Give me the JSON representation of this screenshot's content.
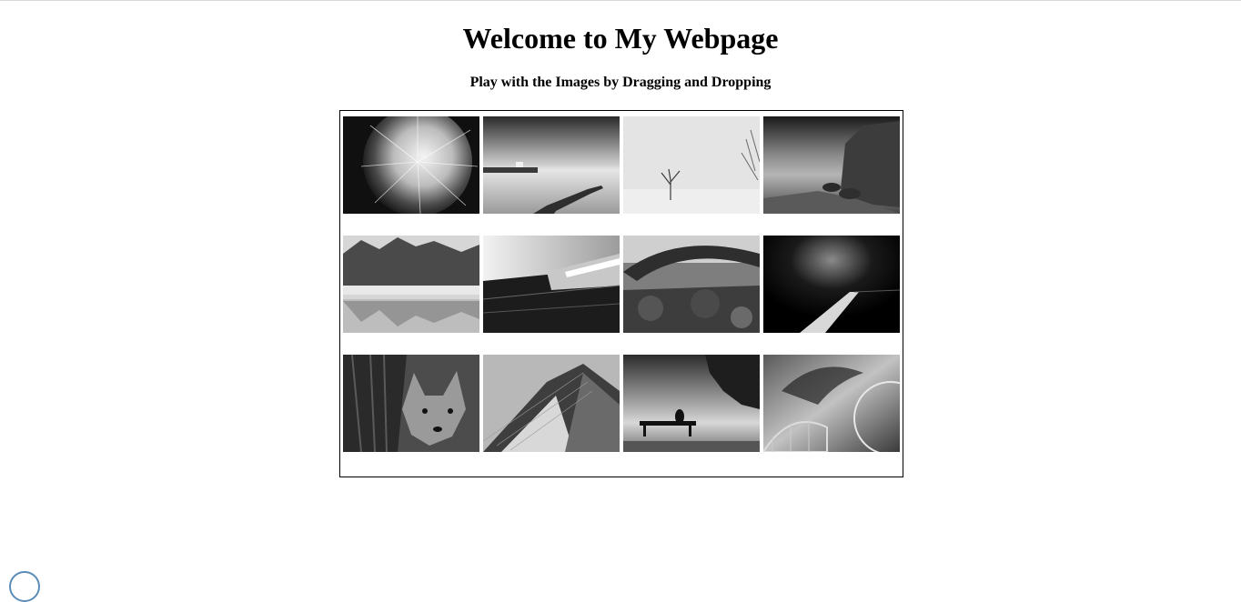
{
  "page": {
    "title": "Welcome to My Webpage",
    "subtitle": "Play with the Images by Dragging and Dropping"
  },
  "gallery": {
    "images": [
      {
        "subject": "dandelion-seed-head"
      },
      {
        "subject": "coastline-long-exposure"
      },
      {
        "subject": "lone-tree-in-fog"
      },
      {
        "subject": "sea-cliffs"
      },
      {
        "subject": "misty-lake-trees"
      },
      {
        "subject": "modern-architecture-reflection"
      },
      {
        "subject": "rock-arch-landscape"
      },
      {
        "subject": "pier-into-darkness"
      },
      {
        "subject": "fox-behind-tree"
      },
      {
        "subject": "glass-skyscraper"
      },
      {
        "subject": "person-on-bench"
      },
      {
        "subject": "rollercoaster-stormy-sky"
      }
    ]
  },
  "colors": {
    "border": "#000000",
    "background": "#ffffff"
  }
}
